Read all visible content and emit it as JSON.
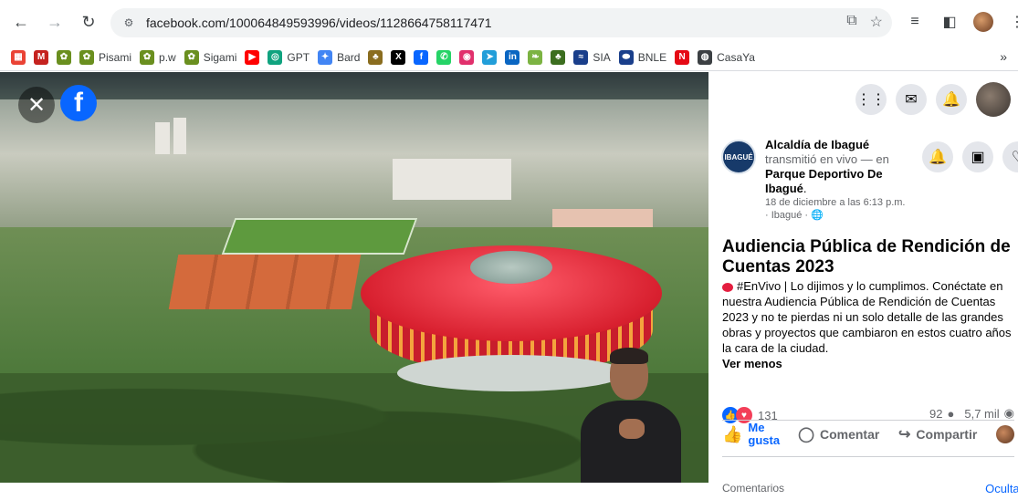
{
  "browser": {
    "url": "facebook.com/100064849593996/videos/1128664758117471",
    "icons": [
      "back-icon",
      "forward-icon",
      "reload-icon",
      "site-info-icon",
      "install-icon",
      "star-icon",
      "media-icon",
      "sidepanel-icon",
      "profile-icon",
      "menu-icon"
    ]
  },
  "bookmarks": [
    {
      "label": "",
      "icon": "apps-icon",
      "color": "#ea4335"
    },
    {
      "label": "",
      "icon": "gmail-icon",
      "color": "#c5221f"
    },
    {
      "label": "",
      "icon": "sigami-icon",
      "color": "#6a8f1f"
    },
    {
      "label": "Pisami",
      "icon": "pisami-icon",
      "color": "#6a8f1f"
    },
    {
      "label": "p.w",
      "icon": "pw-icon",
      "color": "#6a8f1f"
    },
    {
      "label": "Sigami",
      "icon": "sigami-icon",
      "color": "#6a8f1f"
    },
    {
      "label": "",
      "icon": "youtube-icon",
      "color": "#ff0000"
    },
    {
      "label": "GPT",
      "icon": "openai-icon",
      "color": "#10a37f"
    },
    {
      "label": "Bard",
      "icon": "bard-icon",
      "color": "#4285f4"
    },
    {
      "label": "",
      "icon": "bookmark-icon",
      "color": "#8a6d1f"
    },
    {
      "label": "",
      "icon": "x-icon",
      "color": "#000000"
    },
    {
      "label": "",
      "icon": "facebook-icon",
      "color": "#0866ff"
    },
    {
      "label": "",
      "icon": "whatsapp-icon",
      "color": "#25d366"
    },
    {
      "label": "",
      "icon": "instagram-icon",
      "color": "#e1306c"
    },
    {
      "label": "",
      "icon": "telegram-icon",
      "color": "#229ed9"
    },
    {
      "label": "",
      "icon": "linkedin-icon",
      "color": "#0a66c2"
    },
    {
      "label": "",
      "icon": "leaf-icon",
      "color": "#7cb342"
    },
    {
      "label": "",
      "icon": "bookmark-icon",
      "color": "#3c6e1f"
    },
    {
      "label": "SIA",
      "icon": "sia-icon",
      "color": "#1a3f8b"
    },
    {
      "label": "BNLE",
      "icon": "bnle-icon",
      "color": "#1a3f8b"
    },
    {
      "label": "",
      "icon": "netflix-icon",
      "color": "#e50914"
    },
    {
      "label": "CasaYa",
      "icon": "globe-icon",
      "color": "#3c4043"
    }
  ],
  "video": {
    "close_icon": "close-icon",
    "logo_letter": "f"
  },
  "panel": {
    "author": {
      "name": "Alcaldía de Ibagué",
      "action": "transmitió en vivo — en",
      "place": "Parque Deportivo De Ibagué",
      "period": ".",
      "date": "18 de diciembre a las 6:13 p.m.",
      "location": "· Ibagué ·"
    },
    "title": "Audiencia Pública de Rendición de Cuentas 2023",
    "body_tag": "#EnVivo",
    "body_text": " | Lo dijimos y lo cumplimos. Conéctate en nuestra Audiencia Pública de Rendición de Cuentas 2023 y no te pierdas ni un solo detalle de las grandes obras y proyectos que cambiaron en estos cuatro años la cara de la ciudad.",
    "see_less": "Ver menos",
    "reactions_count": "131",
    "comments_count": "92",
    "views_count": "5,7 mil",
    "actions": {
      "like": "Me gusta",
      "comment": "Comentar",
      "share": "Compartir"
    },
    "comments_label": "Comentarios",
    "hide_label": "Ocultar"
  }
}
